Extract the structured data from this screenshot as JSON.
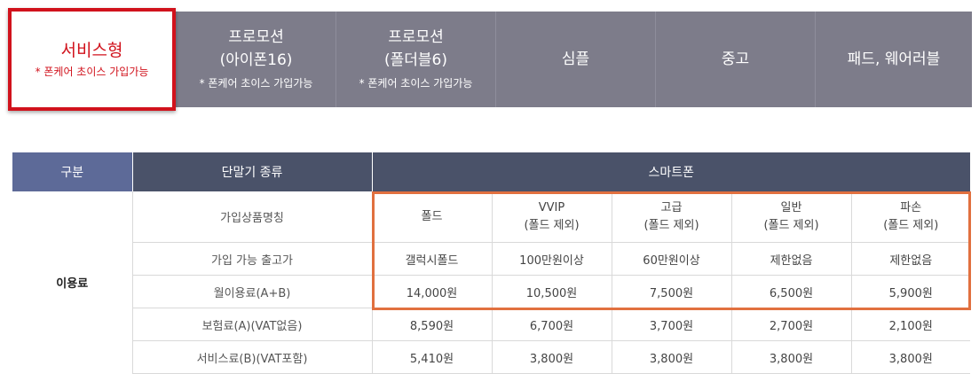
{
  "tabs": {
    "active": {
      "label": "서비스형",
      "note": "* 폰케어 초이스 가입가능"
    },
    "items": [
      {
        "line1": "프로모션",
        "line2": "(아이폰16)",
        "note": "* 폰케어 초이스 가입가능"
      },
      {
        "line1": "프로모션",
        "line2": "(폴더블6)",
        "note": "* 폰케어 초이스 가입가능"
      },
      {
        "line1": "심플",
        "line2": "",
        "note": ""
      },
      {
        "line1": "중고",
        "line2": "",
        "note": ""
      },
      {
        "line1": "패드, 웨어러블",
        "line2": "",
        "note": ""
      }
    ]
  },
  "table": {
    "headers": {
      "gubun": "구분",
      "device_type": "단말기 종류",
      "smartphone": "스마트폰"
    },
    "row_group": "이용료",
    "labels": {
      "product": "가입상품명칭",
      "price_range": "가입 가능 출고가",
      "monthly": "월이용료(A+B)",
      "insurance": "보험료(A)(VAT없음)",
      "service": "서비스료(B)(VAT포함)"
    },
    "columns": [
      {
        "name": "폴드",
        "sub": ""
      },
      {
        "name": "VVIP",
        "sub": "(폴드 제외)"
      },
      {
        "name": "고급",
        "sub": "(폴드 제외)"
      },
      {
        "name": "일반",
        "sub": "(폴드 제외)"
      },
      {
        "name": "파손",
        "sub": "(폴드 제외)"
      }
    ],
    "price_range": [
      "갤럭시폴드",
      "100만원이상",
      "60만원이상",
      "제한없음",
      "제한없음"
    ],
    "monthly": [
      "14,000원",
      "10,500원",
      "7,500원",
      "6,500원",
      "5,900원"
    ],
    "insurance": [
      "8,590원",
      "6,700원",
      "3,700원",
      "2,700원",
      "2,100원"
    ],
    "service": [
      "5,410원",
      "3,800원",
      "3,800원",
      "3,800원",
      "3,800원"
    ]
  },
  "colors": {
    "tab_bg": "#7d7c8a",
    "active_border": "#d1121c",
    "header_bg": "#4a5269",
    "gubun_bg": "#5d6a98",
    "highlight_border": "#e1703f"
  }
}
